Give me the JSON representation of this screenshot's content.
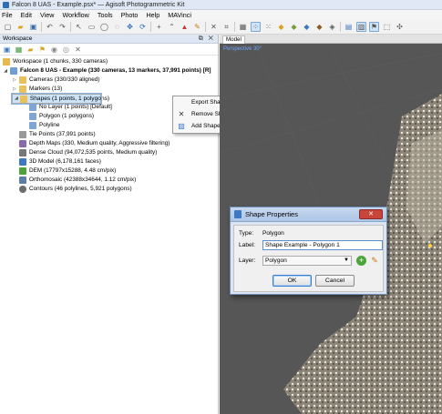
{
  "window": {
    "title": "Falcon 8 UAS - Example.psx* — Agisoft Photogrammetric Kit"
  },
  "menu": [
    "File",
    "Edit",
    "View",
    "Workflow",
    "Tools",
    "Photo",
    "Help",
    "MAVinci"
  ],
  "workspace_panel": {
    "title": "Workspace",
    "close_glyph": "✕",
    "tree": {
      "root": "Workspace (1 chunks, 330 cameras)",
      "chunk": "Falcon 8 UAS - Example (330 cameras, 13 markers, 37,991 points) [R]",
      "cameras": "Cameras (330/330 aligned)",
      "markers": "Markers (13)",
      "shapes": "Shapes (1 points, 1 polygons)",
      "no_layer": "No Layer (1 points) [Default]",
      "polygon_group": "Polygon (1 polygons)",
      "polyline": "Polyline",
      "tie_points": "Tie Points (37,991 points)",
      "depth_maps": "Depth Maps (330, Medium quality, Aggressive filtering)",
      "dense_cloud": "Dense Cloud (94,072,535 points, Medium quality)",
      "model_3d": "3D Model (6,178,161 faces)",
      "dem": "DEM (17797x15288, 4.48 cm/pix)",
      "orthomosaic": "Orthomosaic (42388x34644, 1.12 cm/pix)",
      "contours": "Contours (46 polylines, 5,921 polygons)"
    }
  },
  "context_menu": {
    "items": [
      "Export Shapes...",
      "Remove Shapes",
      "Add Shape Layer"
    ]
  },
  "model_panel": {
    "tab": "Model",
    "view_label": "Perspective 30°"
  },
  "shape_properties_dialog": {
    "title": "Shape Properties",
    "close_glyph": "✕",
    "type_label": "Type:",
    "type_value": "Polygon",
    "label_label": "Label:",
    "label_value": "Shape Example - Polygon 1",
    "layer_label": "Layer:",
    "layer_value": "Polygon",
    "ok_label": "OK",
    "cancel_label": "Cancel"
  },
  "colors": {
    "selection": "#cde3f8",
    "dialog_close": "#c9443a",
    "viewport_bg": "#565656"
  }
}
